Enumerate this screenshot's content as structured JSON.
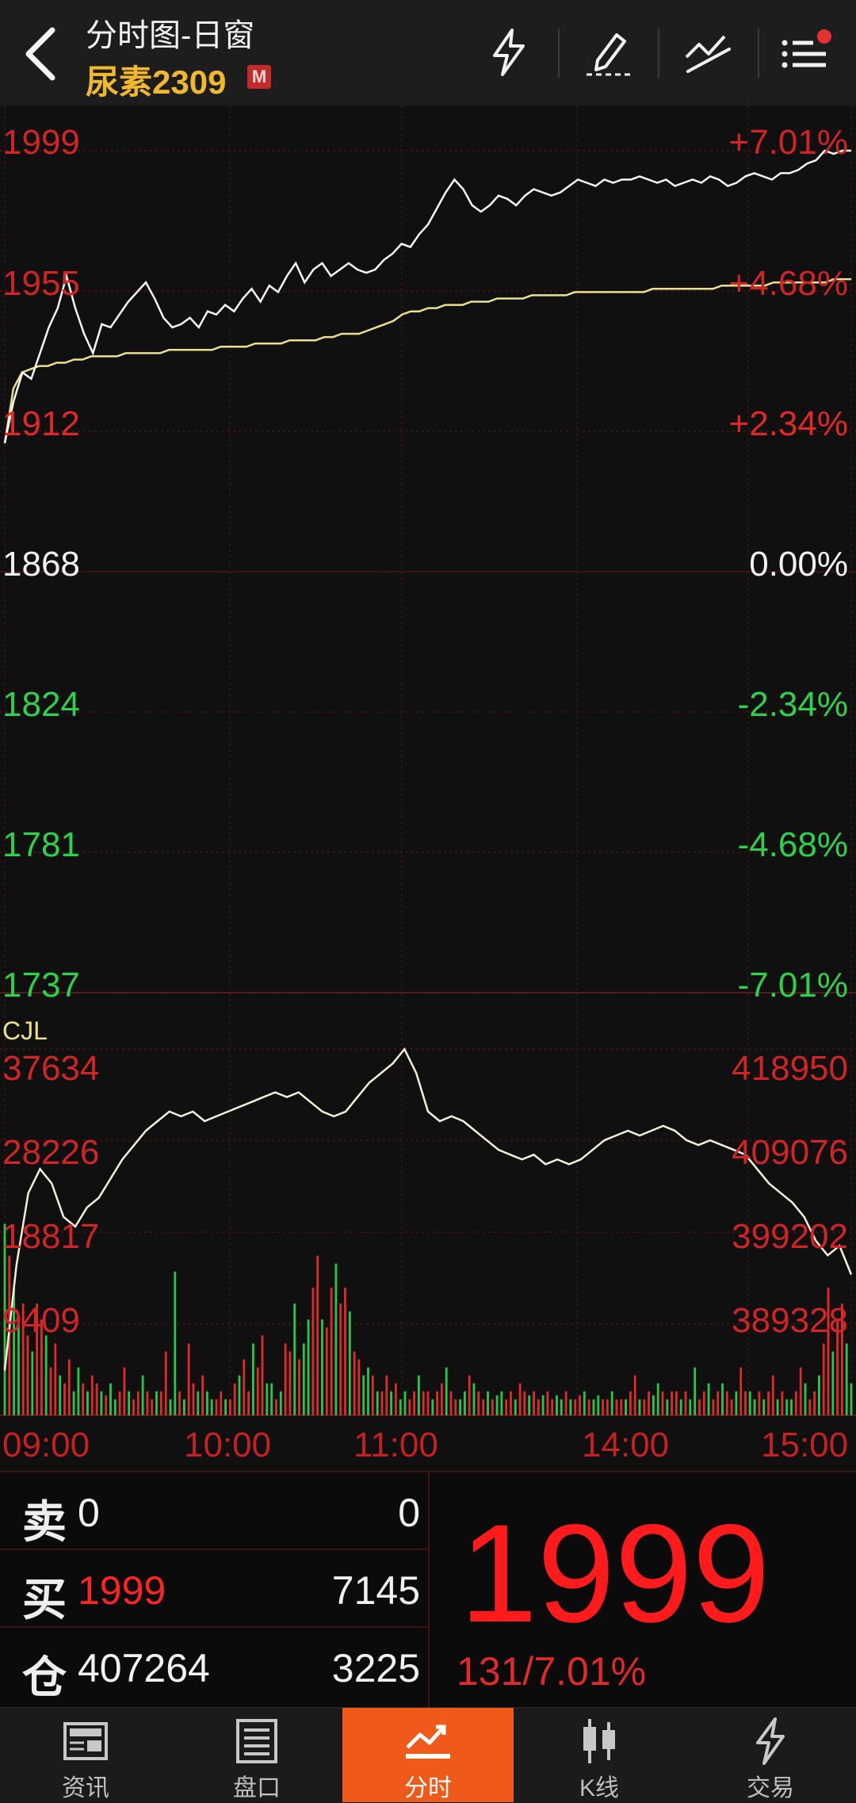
{
  "header": {
    "title": "分时图-日窗",
    "symbol": "尿素2309",
    "badge": "M"
  },
  "price_axis": {
    "left": [
      "1999",
      "1955",
      "1912",
      "1868",
      "1824",
      "1781",
      "1737"
    ],
    "right": [
      "+7.01%",
      "+4.68%",
      "+2.34%",
      "0.00%",
      "-2.34%",
      "-4.68%",
      "-7.01%"
    ]
  },
  "volume_axis": {
    "title": "CJL",
    "left": [
      "37634",
      "28226",
      "18817",
      "9409"
    ],
    "right": [
      "418950",
      "409076",
      "399202",
      "389328"
    ]
  },
  "time_axis": [
    "09:00",
    "10:00",
    "11:00",
    "14:00",
    "15:00"
  ],
  "quote": {
    "sell_label": "卖",
    "sell_price": "0",
    "sell_volume": "0",
    "buy_label": "买",
    "buy_price": "1999",
    "buy_volume": "7145",
    "pos_label": "仓",
    "pos_value": "407264",
    "pos_change": "3225",
    "last_price": "1999",
    "change_text": "131/7.01%"
  },
  "tabs": [
    {
      "label": "资讯",
      "icon": "news-icon"
    },
    {
      "label": "盘口",
      "icon": "orderbook-icon"
    },
    {
      "label": "分时",
      "icon": "timeshare-icon",
      "active": true
    },
    {
      "label": "K线",
      "icon": "candlestick-icon"
    },
    {
      "label": "交易",
      "icon": "trade-icon"
    }
  ],
  "chart_data": [
    {
      "type": "line",
      "series": [
        {
          "values": [
            1908,
            1921,
            1930,
            1928,
            1936,
            1944,
            1950,
            1960,
            1950,
            1942,
            1936,
            1945,
            1944,
            1948,
            1952,
            1955,
            1958,
            1953,
            1947,
            1944,
            1945,
            1947,
            1944,
            1949,
            1948,
            1951,
            1949,
            1953,
            1956,
            1952,
            1957,
            1955,
            1960,
            1964,
            1958,
            1962,
            1964,
            1960,
            1962,
            1964,
            1962,
            1961,
            1962,
            1965,
            1967,
            1970,
            1969,
            1973,
            1976,
            1981,
            1986,
            1990,
            1987,
            1982,
            1980,
            1982,
            1985,
            1984,
            1982,
            1985,
            1987,
            1986,
            1985,
            1986,
            1988,
            1990,
            1989,
            1988,
            1990,
            1989,
            1990,
            1990,
            1991,
            1990,
            1989,
            1990,
            1988,
            1989,
            1990,
            1989,
            1991,
            1990,
            1988,
            1989,
            1991,
            1992,
            1991,
            1990,
            1992,
            1992,
            1993,
            1995,
            1996,
            1999,
            1998,
            1999,
            1999
          ]
        },
        {
          "values": [
            1908,
            1925,
            1930,
            1931,
            1932,
            1932,
            1933,
            1933,
            1934,
            1934,
            1935,
            1935,
            1935,
            1935,
            1936,
            1936,
            1936,
            1936,
            1936,
            1937,
            1937,
            1937,
            1937,
            1937,
            1937,
            1938,
            1938,
            1938,
            1938,
            1939,
            1939,
            1939,
            1939,
            1940,
            1940,
            1940,
            1940,
            1941,
            1941,
            1942,
            1942,
            1942,
            1943,
            1944,
            1945,
            1946,
            1948,
            1949,
            1949,
            1950,
            1950,
            1951,
            1951,
            1951,
            1952,
            1952,
            1952,
            1953,
            1953,
            1953,
            1953,
            1954,
            1954,
            1954,
            1954,
            1954,
            1955,
            1955,
            1955,
            1955,
            1955,
            1955,
            1955,
            1955,
            1955,
            1956,
            1956,
            1956,
            1956,
            1956,
            1956,
            1956,
            1956,
            1957,
            1957,
            1957,
            1957,
            1957,
            1957,
            1958,
            1958,
            1958,
            1958,
            1958,
            1958,
            1958,
            1959,
            1959,
            1959
          ]
        }
      ],
      "ylim": [
        1737,
        1999
      ]
    },
    {
      "type": "bar",
      "series": [
        {
          "values": [
            24000,
            20000,
            16000,
            12000,
            14000,
            10000,
            8000,
            14000,
            12000,
            10000,
            6000,
            9000,
            5000,
            4000,
            7000,
            3000,
            6000,
            4000,
            3000,
            5000,
            4000,
            3000,
            2500,
            4000,
            2000,
            3000,
            6000,
            3000,
            2000,
            3000,
            5000,
            3000,
            2000,
            3000,
            3000,
            8000,
            2000,
            18000,
            3000,
            2000,
            9000,
            4000,
            3000,
            5000,
            3000,
            2000,
            2000,
            3000,
            2000,
            2000,
            4000,
            5000,
            7000,
            3000,
            9000,
            6000,
            10000,
            4000,
            4000,
            2000,
            3000,
            9000,
            8000,
            14000,
            7000,
            9000,
            12000,
            16000,
            20000,
            12000,
            11000,
            16000,
            19000,
            14000,
            16000,
            13000,
            8000,
            7000,
            5000,
            6000,
            5000,
            3000,
            3000,
            5000,
            3000,
            4000,
            2000,
            3000,
            2000,
            3000,
            5000,
            3000,
            3000,
            2000,
            3000,
            4000,
            6000,
            3000,
            2000,
            2000,
            3000,
            5000,
            4000,
            3000,
            2000,
            3000,
            2000,
            2500,
            3000,
            2000,
            3000,
            2000,
            4000,
            3000,
            2500,
            3000,
            2000,
            2500,
            3000,
            2000,
            2500,
            2000,
            3000,
            2000,
            2000,
            2500,
            3000,
            2000,
            2000,
            2500,
            2000,
            2000,
            3000,
            2000,
            2000,
            2000,
            3000,
            5000,
            2000,
            2000,
            3000,
            2500,
            4000,
            3000,
            2000,
            3000,
            3000,
            2000,
            3000,
            2000,
            6000,
            2000,
            3000,
            4000,
            2000,
            3000,
            4000,
            3000,
            2000,
            3000,
            6000,
            3000,
            3000,
            2000,
            3000,
            2000,
            3000,
            5000,
            2000,
            3000,
            2000,
            2000,
            3000,
            6000,
            4000,
            2000,
            3000,
            5000,
            9000,
            16000,
            8000,
            12000,
            14000,
            9000,
            4000
          ]
        },
        {
          "values": [
            1908,
            1930,
            1945,
            1950,
            1947,
            1940,
            1938,
            1942,
            1944,
            1948,
            1952,
            1955,
            1958,
            1960,
            1962,
            1961,
            1962,
            1960,
            1961,
            1962,
            1963,
            1964,
            1965,
            1966,
            1965,
            1966,
            1964,
            1962,
            1961,
            1962,
            1965,
            1968,
            1970,
            1972,
            1975,
            1970,
            1962,
            1960,
            1961,
            1960,
            1958,
            1956,
            1954,
            1953,
            1952,
            1953,
            1951,
            1952,
            1951,
            1952,
            1954,
            1956,
            1957,
            1958,
            1957,
            1958,
            1959,
            1958,
            1956,
            1955,
            1956,
            1955,
            1954,
            1953,
            1950,
            1947,
            1945,
            1943,
            1940,
            1935,
            1932,
            1934,
            1928
          ]
        }
      ]
    }
  ]
}
